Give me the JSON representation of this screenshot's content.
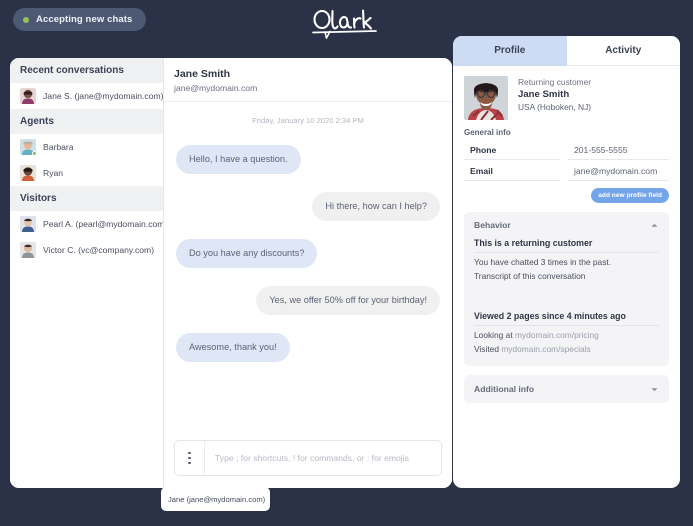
{
  "topbar": {
    "status_label": "Accepting new chats",
    "status_dot_color": "#96c25e",
    "logo_text": "Olark"
  },
  "sidebar": {
    "sections": [
      {
        "heading": "Recent conversations",
        "items": [
          {
            "label": "Jane S. (jane@mydomain.com)",
            "online": false,
            "avatar": "woman-purple"
          }
        ]
      },
      {
        "heading": "Agents",
        "items": [
          {
            "label": "Barbara",
            "online": true,
            "avatar": "woman-hat"
          },
          {
            "label": "Ryan",
            "online": false,
            "avatar": "man-beard"
          }
        ]
      },
      {
        "heading": "Visitors",
        "items": [
          {
            "label": "Pearl A. (pearl@mydomain.com)",
            "online": false,
            "avatar": "man-blue"
          },
          {
            "label": "Victor C. (vc@company.com)",
            "online": false,
            "avatar": "man-grey"
          }
        ]
      }
    ]
  },
  "chat": {
    "header": {
      "name": "Jane Smith",
      "email": "jane@mydomain.com"
    },
    "daystamp": "Friday, January 10 2020 2:34 PM",
    "messages": [
      {
        "dir": "in",
        "text": "Hello, I have a question."
      },
      {
        "dir": "out",
        "text": "Hi there, how can I help?"
      },
      {
        "dir": "in",
        "text": "Do you have any discounts?"
      },
      {
        "dir": "out",
        "text": "Yes, we offer 50% off for your birthday!"
      },
      {
        "dir": "in",
        "text": "Awesome, thank you!"
      }
    ],
    "composer": {
      "placeholder": "Type ; for shortcuts, ! for commands, or : for emojis",
      "value": "",
      "menu_icon": "vertical-ellipsis-icon"
    },
    "bottom_tab_label": "Jane (jane@mydomain.com)"
  },
  "panel": {
    "tabs": [
      {
        "label": "Profile",
        "active": true
      },
      {
        "label": "Activity",
        "active": false
      }
    ],
    "profile": {
      "returning_label": "Returning customer",
      "name": "Jane Smith",
      "location": "USA (Hoboken, NJ)",
      "avatar": "woman-glasses-plaid"
    },
    "general_info": {
      "label": "General info",
      "fields": [
        {
          "key": "Phone",
          "value": "201-555-5555"
        },
        {
          "key": "Email",
          "value": "jane@mydomain.com"
        }
      ],
      "add_button": "add new profile field",
      "add_button_color": "#74a5e8"
    },
    "behavior": {
      "heading": "Behavior",
      "expanded": true,
      "chevron": "chevron-up-icon",
      "returning_title": "This is a returning customer",
      "chatted_line": "You have chatted 3 times in the past.",
      "transcript_line": "Transcript of this conversation",
      "pages_title": "Viewed 2 pages since 4 minutes ago",
      "looking_label": "Looking at",
      "looking_url": "mydomain.com/pricing",
      "visited_label": "Visited",
      "visited_url": "mydomain.com/specials"
    },
    "additional_info": {
      "heading": "Additional info",
      "expanded": false,
      "chevron": "chevron-down-icon"
    }
  }
}
